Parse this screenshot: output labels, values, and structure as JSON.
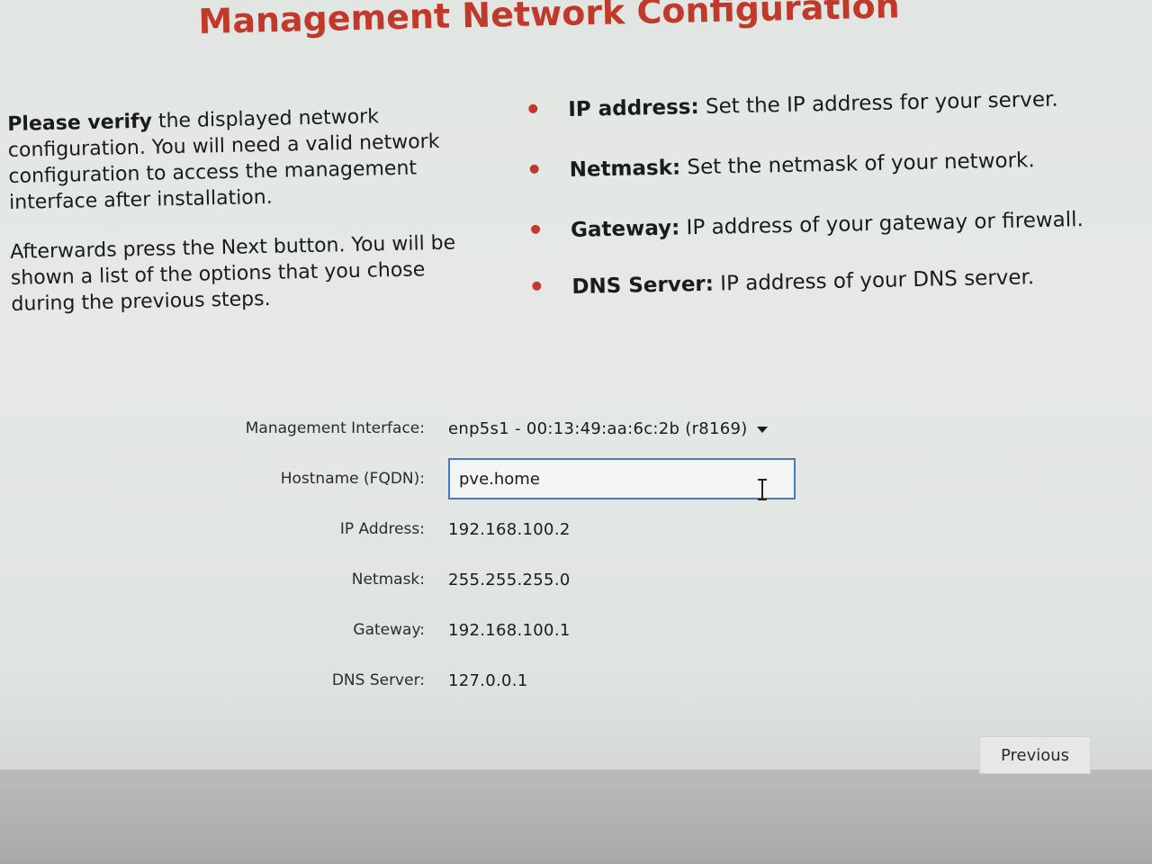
{
  "page": {
    "title": "Management Network Configuration"
  },
  "intro": {
    "p1_bold": "Please verify",
    "p1_rest": " the displayed network configuration. You will need a valid network configuration to access the management interface after installation.",
    "p2": "Afterwards press the Next button. You will be shown a list of the options that you chose during the previous steps."
  },
  "help": {
    "items": [
      {
        "term": "IP address:",
        "desc": " Set the IP address for your server."
      },
      {
        "term": "Netmask:",
        "desc": " Set the netmask of your network."
      },
      {
        "term": "Gateway:",
        "desc": " IP address of your gateway or firewall."
      },
      {
        "term": "DNS Server:",
        "desc": " IP address of your DNS server."
      }
    ]
  },
  "form": {
    "interface": {
      "label": "Management Interface:",
      "value": "enp5s1 - 00:13:49:aa:6c:2b (r8169)"
    },
    "hostname": {
      "label": "Hostname (FQDN):",
      "value": "pve.home"
    },
    "ip": {
      "label": "IP Address:",
      "value": "192.168.100.2"
    },
    "netmask": {
      "label": "Netmask:",
      "value": "255.255.255.0"
    },
    "gateway": {
      "label": "Gateway:",
      "value": "192.168.100.1"
    },
    "dns": {
      "label": "DNS Server:",
      "value": "127.0.0.1"
    }
  },
  "buttons": {
    "previous": "Previous"
  },
  "colors": {
    "accent": "#c0392b",
    "focus_border": "#4a78c4"
  },
  "icons": {
    "dropdown": "chevron-down-icon",
    "bullet": "bullet-icon",
    "cursor": "text-cursor-icon"
  }
}
